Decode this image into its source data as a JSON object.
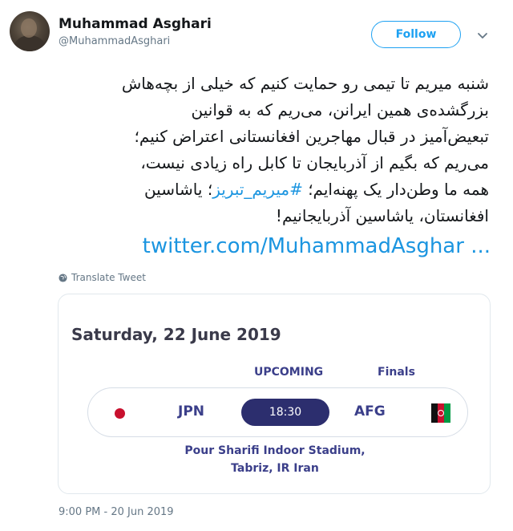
{
  "author": {
    "name": "Muhammad Asghari",
    "handle": "@MuhammadAsghari"
  },
  "actions": {
    "follow_label": "Follow"
  },
  "tweet": {
    "lines": [
      "شنبه میریم تا تیمی رو حمایت کنیم که خیلی از بچه‌هاش",
      "بزرگشده‌ی همین ایرانن، می‌ریم که به قوانین",
      "تبعیض‌آمیز در قبال مهاجرین افغانستانی اعتراض کنیم؛",
      "می‌ریم که بگیم از آذربایجان تا کابل راه زیادی نیست،",
      "افغانستان، یاشاسین آذربایجانیم!"
    ],
    "line5_before": "همه ما وطن‌دار یک پهنه‌ایم؛ ",
    "hashtag": "#میریم_تبریز",
    "line5_after": "؛ یاشاسین",
    "link": "twitter.com/MuhammadAsghar ...",
    "translate_label": "Translate Tweet",
    "timestamp": "9:00 PM - 20 Jun 2019"
  },
  "card": {
    "date": "Saturday, 22 June 2019",
    "status": "UPCOMING",
    "stage": "Finals",
    "home_team": "JPN",
    "away_team": "AFG",
    "time": "18:30",
    "venue_line1": "Pour Sharifi Indoor Stadium,",
    "venue_line2": "Tabriz, IR Iran"
  },
  "colors": {
    "accent": "#1da1f2",
    "link": "#1b95e0",
    "card_text": "#3b3f8a",
    "time_pill": "#2c2e6e",
    "muted": "#657786"
  },
  "icons": {
    "caret": "chevron-down-icon",
    "translate": "globe-icon",
    "home_flag": "japan-flag-icon",
    "away_flag": "afghanistan-flag-icon"
  }
}
